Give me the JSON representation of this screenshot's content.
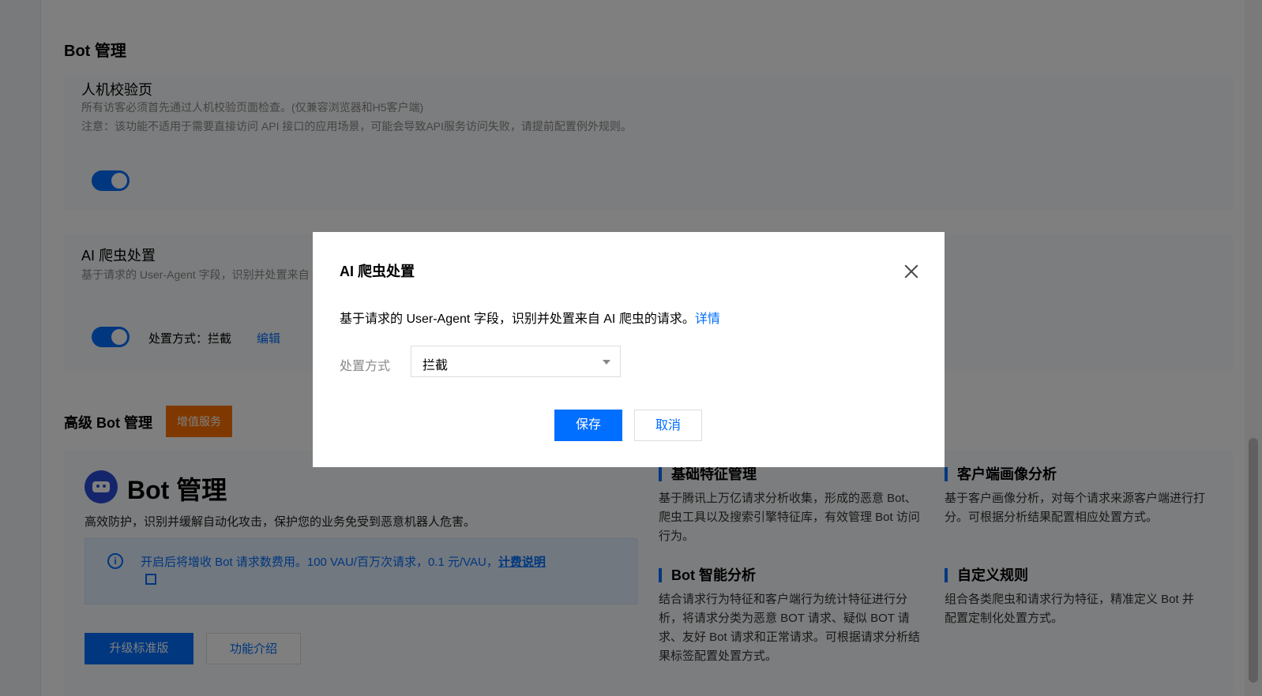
{
  "bot_section": {
    "title": "Bot 管理",
    "captcha_card": {
      "title": "人机校验页",
      "desc_line1": "所有访客必须首先通过人机校验页面检查。(仅兼容浏览器和H5客户端)",
      "desc_line2": "注意：该功能不适用于需要直接访问 API 接口的应用场景，可能会导致API服务访问失败，请提前配置例外规则。",
      "toggle_on": true
    },
    "ai_crawler_card": {
      "title": "AI 爬虫处置",
      "desc": "基于请求的 User-Agent 字段，识别并处置来自 AI 爬虫的请求。",
      "mode_text": "处置方式：拦截",
      "edit_label": "编辑",
      "toggle_on": true
    }
  },
  "advanced_section": {
    "title": "高级 Bot 管理",
    "badge": "增值服务",
    "product_title": "Bot 管理",
    "product_desc": "高效防护，识别并缓解自动化攻击，保护您的业务免受到恶意机器人危害。",
    "info_text": "开启后将增收 Bot 请求数费用。100 VAU/百万次请求，0.1 元/VAU，",
    "info_link": "计费说明",
    "upgrade_btn": "升级标准版",
    "intro_btn": "功能介绍",
    "features": [
      {
        "title": "基础特征管理",
        "desc": "基于腾讯上万亿请求分析收集，形成的恶意 Bot、爬虫工具以及搜索引擎特征库，有效管理 Bot 访问行为。"
      },
      {
        "title": "客户端画像分析",
        "desc": "基于客户画像分析，对每个请求来源客户端进行打分。可根据分析结果配置相应处置方式。"
      },
      {
        "title": "Bot 智能分析",
        "desc": "结合请求行为特征和客户端行为统计特征进行分析，将请求分类为恶意 BOT 请求、疑似 BOT 请求、友好 Bot 请求和正常请求。可根据请求分析结果标签配置处置方式。"
      },
      {
        "title": "自定义规则",
        "desc": "组合各类爬虫和请求行为特征，精准定义 Bot 并配置定制化处置方式。"
      }
    ]
  },
  "modal": {
    "title": "AI 爬虫处置",
    "desc": "基于请求的 User-Agent 字段，识别并处置来自 AI 爬虫的请求。",
    "detail_link": "详情",
    "field_label": "处置方式",
    "select_value": "拦截",
    "save_label": "保存",
    "cancel_label": "取消"
  },
  "colors": {
    "primary": "#006eff",
    "badge": "#ff7200",
    "overlay": "rgba(0,0,0,0.5)"
  }
}
